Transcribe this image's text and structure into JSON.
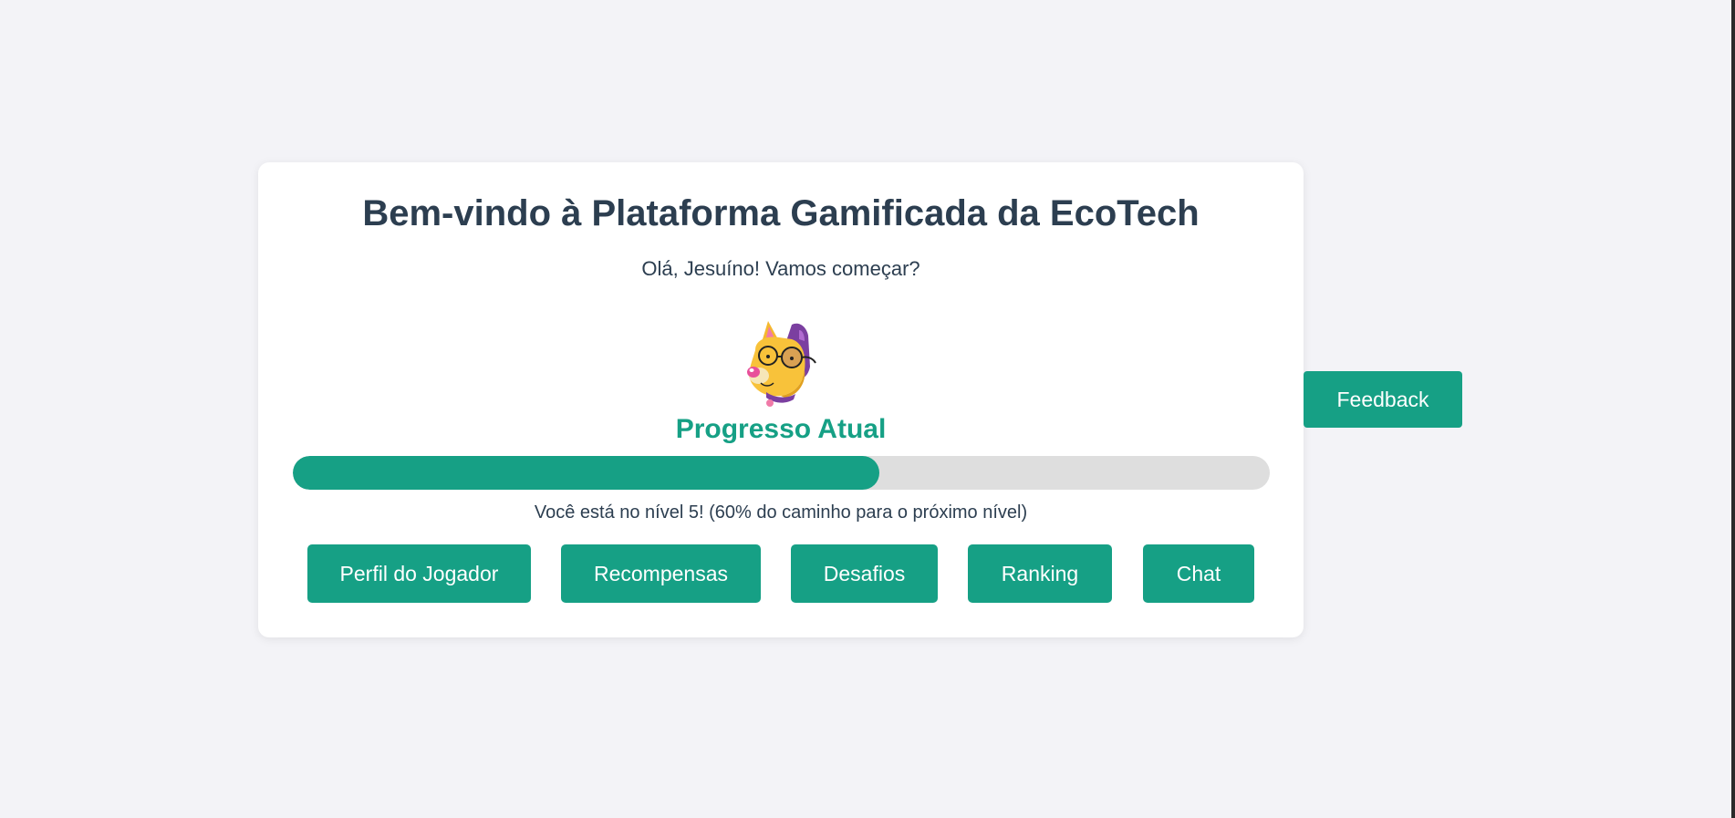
{
  "main": {
    "title": "Bem-vindo à Plataforma Gamificada da EcoTech",
    "greeting": "Olá, Jesuíno! Vamos começar?",
    "mascot_icon": "dog-with-glasses-icon"
  },
  "progress": {
    "title": "Progresso Atual",
    "percent": 60,
    "status_text": "Você está no nível 5! (60% do caminho para o próximo nível)"
  },
  "nav": {
    "buttons": [
      {
        "label": "Perfil do Jogador"
      },
      {
        "label": "Recompensas"
      },
      {
        "label": "Desafios"
      },
      {
        "label": "Ranking"
      },
      {
        "label": "Chat"
      }
    ]
  },
  "feedback": {
    "label": "Feedback"
  },
  "colors": {
    "accent": "#16a085",
    "heading": "#2c3e50",
    "track": "#dedede",
    "background": "#f3f3f7"
  }
}
